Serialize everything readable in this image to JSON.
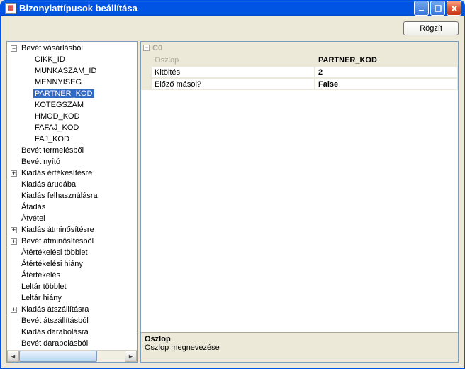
{
  "window": {
    "title": "Bizonylattípusok beállítása"
  },
  "toolbar": {
    "save_label": "Rögzít"
  },
  "tree": [
    {
      "depth": 0,
      "toggle": "-",
      "label": "Bevét vásárlásból",
      "selected": false
    },
    {
      "depth": 1,
      "toggle": "",
      "label": "CIKK_ID"
    },
    {
      "depth": 1,
      "toggle": "",
      "label": "MUNKASZAM_ID"
    },
    {
      "depth": 1,
      "toggle": "",
      "label": "MENNYISEG"
    },
    {
      "depth": 1,
      "toggle": "",
      "label": "PARTNER_KOD",
      "selected": true
    },
    {
      "depth": 1,
      "toggle": "",
      "label": "KOTEGSZAM"
    },
    {
      "depth": 1,
      "toggle": "",
      "label": "HMOD_KOD"
    },
    {
      "depth": 1,
      "toggle": "",
      "label": "FAFAJ_KOD"
    },
    {
      "depth": 1,
      "toggle": "",
      "label": "FAJ_KOD"
    },
    {
      "depth": 0,
      "toggle": "",
      "label": "Bevét termelésből"
    },
    {
      "depth": 0,
      "toggle": "",
      "label": "Bevét nyító"
    },
    {
      "depth": 0,
      "toggle": "+",
      "label": "Kiadás értékesítésre"
    },
    {
      "depth": 0,
      "toggle": "",
      "label": "Kiadás árudába"
    },
    {
      "depth": 0,
      "toggle": "",
      "label": "Kiadás felhasználásra"
    },
    {
      "depth": 0,
      "toggle": "",
      "label": "Átadás"
    },
    {
      "depth": 0,
      "toggle": "",
      "label": "Átvétel"
    },
    {
      "depth": 0,
      "toggle": "+",
      "label": "Kiadás átminősítésre"
    },
    {
      "depth": 0,
      "toggle": "+",
      "label": "Bevét átminősítésből"
    },
    {
      "depth": 0,
      "toggle": "",
      "label": "Átértékelési többlet"
    },
    {
      "depth": 0,
      "toggle": "",
      "label": "Átértékelési hiány"
    },
    {
      "depth": 0,
      "toggle": "",
      "label": "Átértékelés"
    },
    {
      "depth": 0,
      "toggle": "",
      "label": "Leltár többlet"
    },
    {
      "depth": 0,
      "toggle": "",
      "label": "Leltár hiány"
    },
    {
      "depth": 0,
      "toggle": "+",
      "label": "Kiadás átszállításra"
    },
    {
      "depth": 0,
      "toggle": "",
      "label": "Bevét átszállításból"
    },
    {
      "depth": 0,
      "toggle": "",
      "label": "Kiadás darabolásra"
    },
    {
      "depth": 0,
      "toggle": "",
      "label": "Bevét darabolásból"
    }
  ],
  "propgrid": {
    "category": "C0",
    "rows": [
      {
        "name": "Oszlop",
        "value": "PARTNER_KOD",
        "header": true
      },
      {
        "name": "Kitöltés",
        "value": "2"
      },
      {
        "name": "Előző másol?",
        "value": "False"
      }
    ],
    "help_title": "Oszlop",
    "help_text": "Oszlop megnevezése"
  }
}
